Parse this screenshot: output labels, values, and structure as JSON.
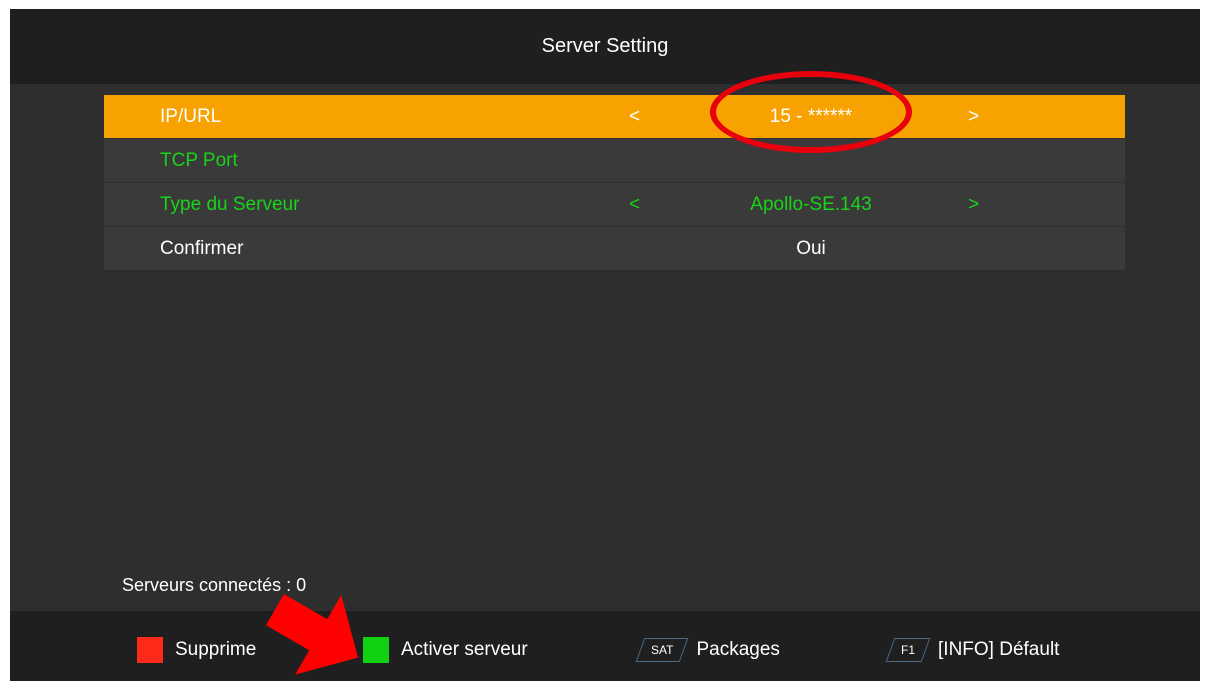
{
  "title": "Server Setting",
  "menu": [
    {
      "label": "IP/URL",
      "value": "15 - ******",
      "left_arrow": "<",
      "right_arrow": ">"
    },
    {
      "label": "TCP Port",
      "value": "",
      "left_arrow": "",
      "right_arrow": ""
    },
    {
      "label": "Type du Serveur",
      "value": "Apollo-SE.143",
      "left_arrow": "<",
      "right_arrow": ">"
    },
    {
      "label": "Confirmer",
      "value": "Oui",
      "left_arrow": "",
      "right_arrow": ""
    }
  ],
  "status": "Serveurs connectés : 0",
  "footer": {
    "red_label": "Supprime",
    "green_label": "Activer serveur",
    "sat_key": "SAT",
    "sat_label": "Packages",
    "f1_key": "F1",
    "f1_label": "[INFO] Défault"
  },
  "colors": {
    "highlight": "#f7a200",
    "active_text": "#18d418",
    "annotation": "#e8000d"
  }
}
